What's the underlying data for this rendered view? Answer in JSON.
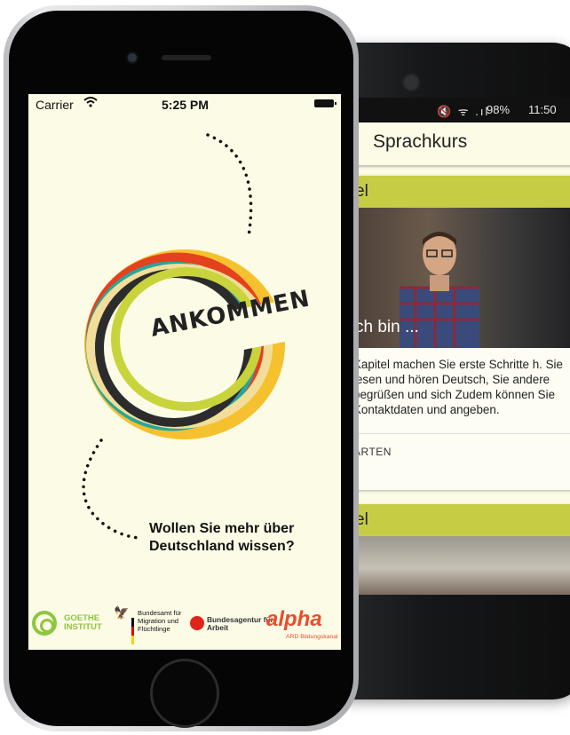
{
  "android": {
    "status": {
      "icons": "🔇 ᯤ .ıl",
      "battery": "98%",
      "time": "11:50"
    },
    "app_bar_title": "Sprachkurs",
    "card1": {
      "header": "el",
      "photo_caption": "ch bin ...",
      "body": "Kapitel machen Sie erste Schritte h. Sie lesen und hören Deutsch, Sie andere begrüßen und sich Zudem können Sie Kontaktdaten und angeben.",
      "action": "ARTEN"
    },
    "card2": {
      "header": "el"
    }
  },
  "iphone": {
    "status": {
      "carrier": "Carrier",
      "time": "5:25 PM"
    },
    "logo_title": "ANKOMMEN",
    "question": "Wollen Sie mehr über Deutschland wissen?",
    "logos": {
      "goethe": "GOETHE INSTITUT",
      "bamf": "Bundesamt für Migration und Flüchtlinge",
      "ba": "Bundesagentur für Arbeit",
      "alpha": "alpha",
      "alpha_sub": "ARD Bildungskanal"
    }
  },
  "colors": {
    "android_accent": "#c6cd45",
    "screen_bg": "#fcfbe6"
  }
}
